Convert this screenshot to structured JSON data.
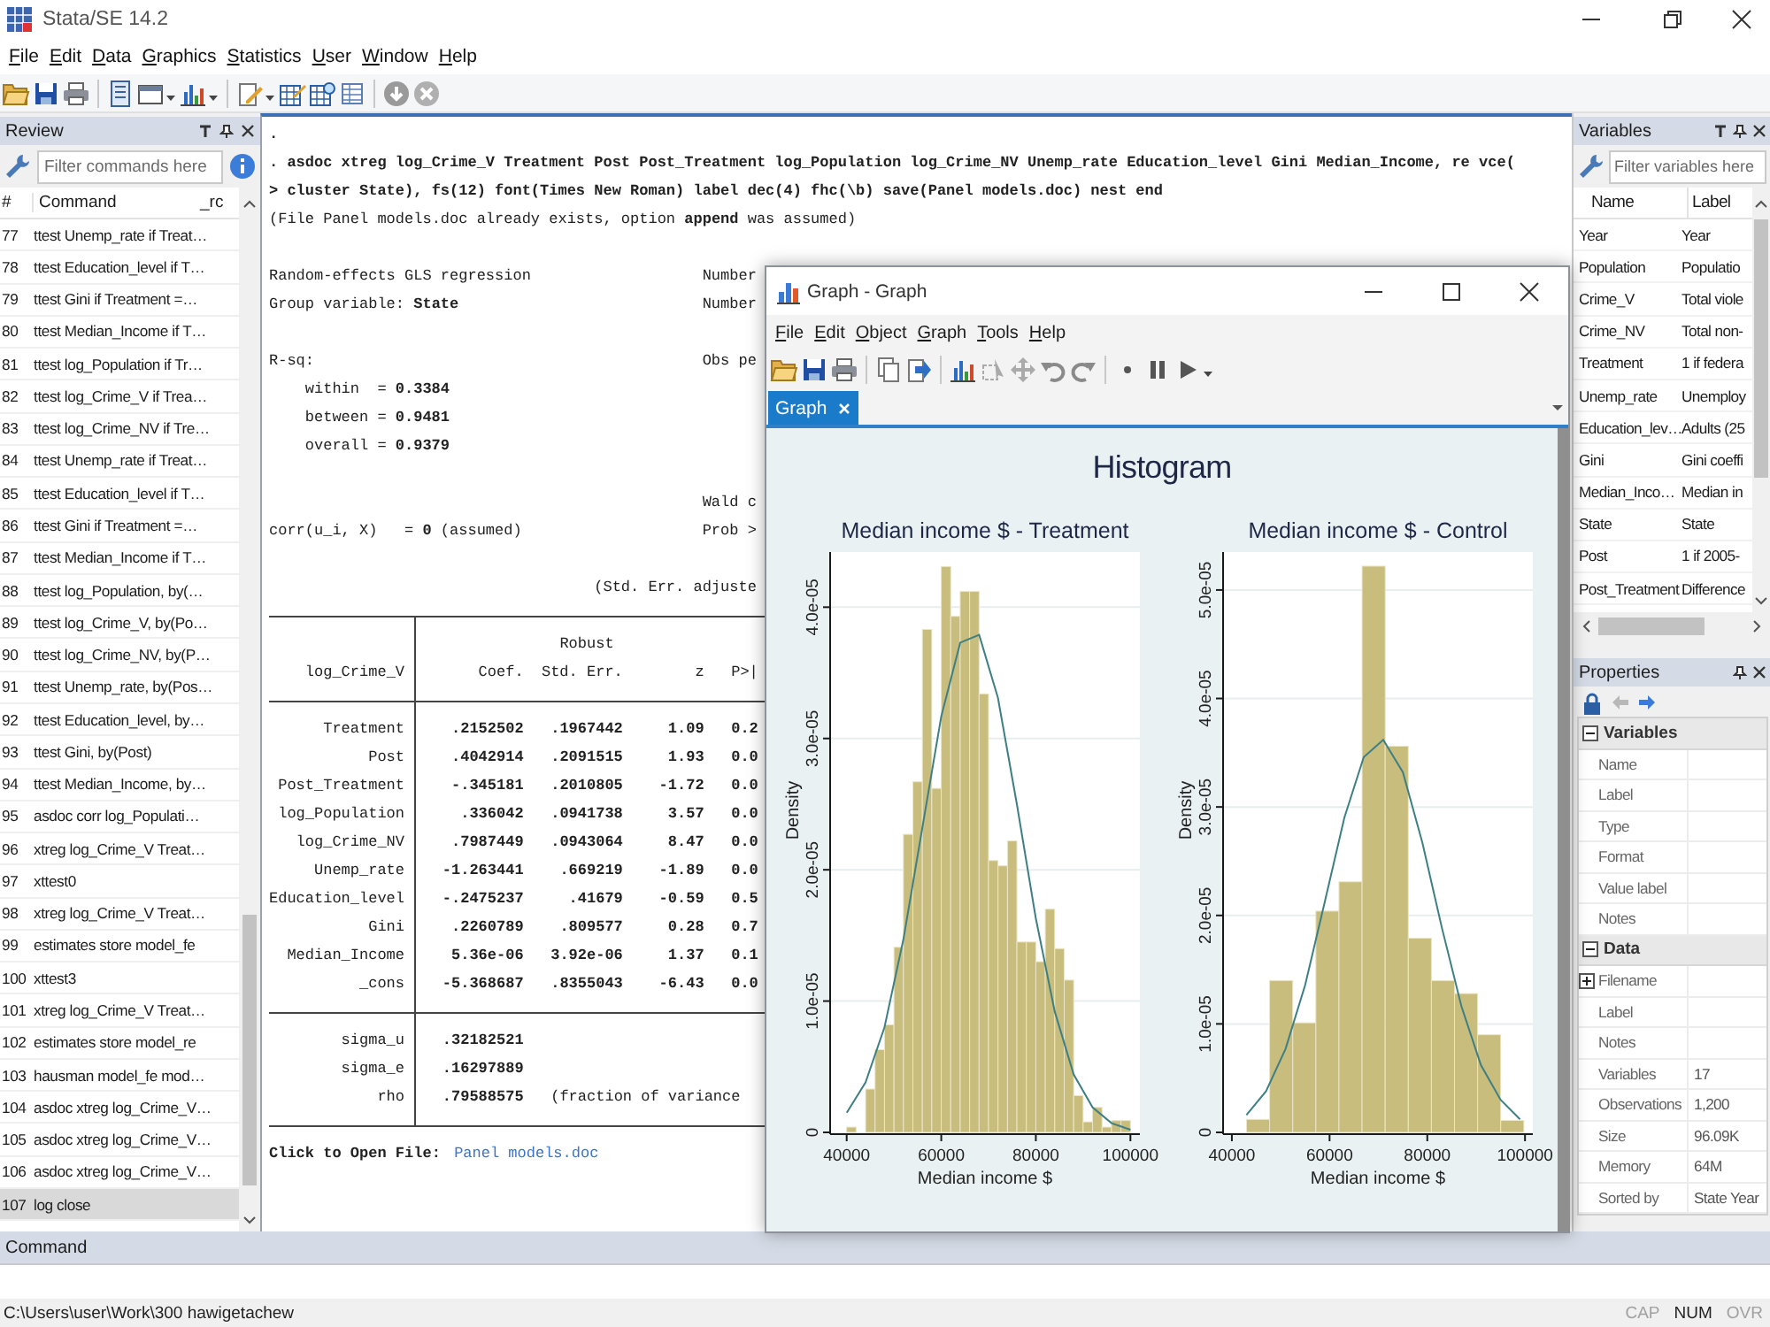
{
  "window": {
    "title": "Stata/SE 14.2"
  },
  "menu": [
    "File",
    "Edit",
    "Data",
    "Graphics",
    "Statistics",
    "User",
    "Window",
    "Help"
  ],
  "review": {
    "title": "Review",
    "filter": {
      "placeholder": "Filter commands here"
    },
    "columns": [
      "#",
      "Command",
      "_rc"
    ],
    "rows": [
      {
        "num": "77",
        "command": "ttest Unemp_rate if Treat…",
        "selected": false
      },
      {
        "num": "78",
        "command": "ttest Education_level if T…",
        "selected": false
      },
      {
        "num": "79",
        "command": "ttest Gini if Treatment =…",
        "selected": false
      },
      {
        "num": "80",
        "command": "ttest Median_Income if T…",
        "selected": false
      },
      {
        "num": "81",
        "command": "ttest log_Population if Tr…",
        "selected": false
      },
      {
        "num": "82",
        "command": "ttest log_Crime_V if Trea…",
        "selected": false
      },
      {
        "num": "83",
        "command": "ttest log_Crime_NV if Tre…",
        "selected": false
      },
      {
        "num": "84",
        "command": "ttest Unemp_rate if Treat…",
        "selected": false
      },
      {
        "num": "85",
        "command": "ttest Education_level if T…",
        "selected": false
      },
      {
        "num": "86",
        "command": "ttest Gini if Treatment =…",
        "selected": false
      },
      {
        "num": "87",
        "command": "ttest Median_Income if T…",
        "selected": false
      },
      {
        "num": "88",
        "command": "ttest log_Population, by(…",
        "selected": false
      },
      {
        "num": "89",
        "command": "ttest log_Crime_V, by(Po…",
        "selected": false
      },
      {
        "num": "90",
        "command": "ttest log_Crime_NV, by(P…",
        "selected": false
      },
      {
        "num": "91",
        "command": "ttest Unemp_rate, by(Pos…",
        "selected": false
      },
      {
        "num": "92",
        "command": "ttest Education_level, by…",
        "selected": false
      },
      {
        "num": "93",
        "command": "ttest Gini, by(Post)",
        "selected": false
      },
      {
        "num": "94",
        "command": "ttest Median_Income, by…",
        "selected": false
      },
      {
        "num": "95",
        "command": "asdoc corr log_Populati…",
        "selected": false
      },
      {
        "num": "96",
        "command": "xtreg log_Crime_V Treat…",
        "selected": false
      },
      {
        "num": "97",
        "command": "xttest0",
        "selected": false
      },
      {
        "num": "98",
        "command": "xtreg log_Crime_V Treat…",
        "selected": false
      },
      {
        "num": "99",
        "command": "estimates store model_fe",
        "selected": false
      },
      {
        "num": "100",
        "command": "xttest3",
        "selected": false
      },
      {
        "num": "101",
        "command": "xtreg log_Crime_V Treat…",
        "selected": false
      },
      {
        "num": "102",
        "command": "estimates store model_re",
        "selected": false
      },
      {
        "num": "103",
        "command": "hausman model_fe mod…",
        "selected": false
      },
      {
        "num": "104",
        "command": "asdoc xtreg log_Crime_V…",
        "selected": false
      },
      {
        "num": "105",
        "command": "asdoc xtreg log_Crime_V…",
        "selected": false
      },
      {
        "num": "106",
        "command": "asdoc xtreg log_Crime_V…",
        "selected": false
      },
      {
        "num": "107",
        "command": "log close",
        "selected": true
      }
    ]
  },
  "results": {
    "echo": [
      {
        "kind": "command",
        "text": "."
      },
      {
        "kind": "command",
        "text": ". asdoc xtreg log_Crime_V Treatment Post Post_Treatment log_Population log_Crime_NV Unemp_rate Education_level Gini Median_Income, re vce("
      },
      {
        "kind": "command",
        "text": "> cluster State), fs(12) font(Times New Roman) label dec(4) fhc(\\b) save(Panel models.doc) nest end"
      },
      {
        "kind": "note",
        "text": "(File Panel models.doc already exists, option **append** was assumed)"
      }
    ],
    "summary": [
      [
        {
          "kind": "plain",
          "text": "Random-effects GLS regression",
          "right": "Number"
        },
        {
          "kind": "plain",
          "text": "Group variable: **State**",
          "right": "Number"
        }
      ],
      [
        {
          "kind": "plain",
          "text": "R-sq:",
          "right": "Obs pe"
        },
        {
          "kind": "sub",
          "text": "within  = **0.3384**"
        },
        {
          "kind": "sub",
          "text": "between = **0.9481**"
        },
        {
          "kind": "sub",
          "text": "overall = **0.9379**"
        }
      ],
      [
        {
          "kind": "plain",
          "right": "Wald c"
        },
        {
          "kind": "plain",
          "text": "corr(u_i, X)   = **0** (assumed)",
          "right": "Prob >"
        }
      ],
      [
        {
          "kind": "note",
          "right": "(Std. Err. adjuste"
        }
      ]
    ],
    "table": {
      "group_header": "Robust",
      "columns": [
        "log_Crime_V",
        "Coef.",
        "Std. Err.",
        "z",
        "P>|"
      ],
      "rows": [
        [
          "Treatment",
          ".2152502",
          ".1967442",
          "1.09",
          "0.2"
        ],
        [
          "Post",
          ".4042914",
          ".2091515",
          "1.93",
          "0.0"
        ],
        [
          "Post_Treatment",
          "-.345181",
          ".2010805",
          "-1.72",
          "0.0"
        ],
        [
          "log_Population",
          ".336042",
          ".0941738",
          "3.57",
          "0.0"
        ],
        [
          "log_Crime_NV",
          ".7987449",
          ".0943064",
          "8.47",
          "0.0"
        ],
        [
          "Unemp_rate",
          "-1.263441",
          ".669219",
          "-1.89",
          "0.0"
        ],
        [
          "Education_level",
          "-.2475237",
          ".41679",
          "-0.59",
          "0.5"
        ],
        [
          "Gini",
          ".2260789",
          ".809577",
          "0.28",
          "0.7"
        ],
        [
          "Median_Income",
          "5.36e-06",
          "3.92e-06",
          "1.37",
          "0.1"
        ],
        [
          "_cons",
          "-5.368687",
          ".8355043",
          "-6.43",
          "0.0"
        ]
      ],
      "stats": [
        {
          "name": "sigma_u",
          "value": ".32182521"
        },
        {
          "name": "sigma_e",
          "value": ".16297889"
        },
        {
          "name": "rho",
          "value": ".79588575",
          "note": "(fraction of variance"
        }
      ]
    },
    "footer": {
      "label": "Click to Open File:",
      "link": "Panel models.doc"
    }
  },
  "graph_window": {
    "title": "Graph - Graph",
    "menu": [
      "File",
      "Edit",
      "Object",
      "Graph",
      "Tools",
      "Help"
    ],
    "tabs": [
      {
        "label": "Graph",
        "selected": true
      }
    ],
    "graph_title": "Histogram",
    "charts": [
      {
        "chart_data": {
          "type": "bar",
          "title": "Median income $ - Treatment",
          "grid": true,
          "xlabel": "Median income $",
          "ylabel": "Density",
          "xlim": [
            36500,
            102000
          ],
          "ylim": [
            0,
            4.42e-05
          ],
          "xticks": [
            40000,
            60000,
            80000,
            100000
          ],
          "yticks": [
            {
              "value": 0,
              "label": "0"
            },
            {
              "value": 1e-05,
              "label": "1.0e-05"
            },
            {
              "value": 2e-05,
              "label": "2.0e-05"
            },
            {
              "value": 3e-05,
              "label": "3.0e-05"
            },
            {
              "value": 4e-05,
              "label": "4.0e-05"
            }
          ],
          "series": [
            {
              "color": "#c8bd7c",
              "x": [
                41000,
                43000,
                45000,
                47000,
                49000,
                51000,
                53000,
                55000,
                57000,
                59000,
                61000,
                63000,
                65000,
                67000,
                69000,
                71000,
                73000,
                75000,
                77000,
                79000,
                81000,
                83000,
                85000,
                87000,
                89000,
                91000,
                93000,
                95000,
                97000,
                99000
              ],
              "values": [
                4e-07,
                0,
                3.3e-06,
                6.3e-06,
                8.2e-06,
                1.41e-05,
                2.27e-05,
                2.67e-05,
                3.83e-05,
                2.62e-05,
                4.31e-05,
                3.93e-05,
                4.12e-05,
                4.12e-05,
                3.34e-05,
                2.07e-05,
                2.03e-05,
                2.22e-05,
                1.45e-05,
                1.45e-05,
                1.3e-05,
                1.7e-05,
                1.4e-05,
                1.16e-05,
                2.8e-06,
                8e-07,
                1.9e-06,
                4e-07,
                9e-07,
                9e-07
              ]
            },
            {
              "type": "line",
              "color": "#3d7f84",
              "x": [
                40000,
                44000,
                48000,
                52000,
                56000,
                60000,
                64000,
                68000,
                72000,
                76000,
                80000,
                84000,
                88000,
                92000,
                96000,
                100000
              ],
              "values": [
                1.5e-06,
                3.8e-06,
                8e-06,
                1.47e-05,
                2.32e-05,
                3.17e-05,
                3.73e-05,
                3.79e-05,
                3.31e-05,
                2.5e-05,
                1.63e-05,
                9.2e-06,
                4.4e-06,
                1.9e-06,
                7e-07,
                2e-07
              ]
            }
          ]
        }
      },
      {
        "chart_data": {
          "type": "bar",
          "title": "Median income $ - Control",
          "grid": true,
          "xlabel": "Median income $",
          "ylabel": "Density",
          "xlim": [
            38200,
            101600
          ],
          "ylim": [
            0,
            5.35e-05
          ],
          "xticks": [
            40000,
            60000,
            80000,
            100000
          ],
          "yticks": [
            {
              "value": 0,
              "label": "0"
            },
            {
              "value": 1e-05,
              "label": "1.0e-05"
            },
            {
              "value": 2e-05,
              "label": "2.0e-05"
            },
            {
              "value": 3e-05,
              "label": "3.0e-05"
            },
            {
              "value": 4e-05,
              "label": "4.0e-05"
            },
            {
              "value": 5e-05,
              "label": "5.0e-05"
            }
          ],
          "series": [
            {
              "color": "#c8bd7c",
              "x": [
                45365,
                50095,
                54825,
                59555,
                64285,
                69015,
                73745,
                78475,
                83205,
                87935,
                92665,
                97395
              ],
              "values": [
                1.2e-06,
                1.4e-05,
                1.01e-05,
                2.04e-05,
                2.31e-05,
                5.22e-05,
                3.56e-05,
                1.79e-05,
                1.4e-05,
                1.28e-05,
                9e-06,
                1.1e-06
              ]
            },
            {
              "type": "line",
              "color": "#3d7f84",
              "x": [
                43000,
                47000,
                51000,
                55000,
                59000,
                63000,
                67000,
                71000,
                75000,
                79000,
                83000,
                87000,
                91000,
                95000,
                99000
              ],
              "values": [
                1.6e-06,
                3.8e-06,
                7.7e-06,
                1.36e-05,
                2.12e-05,
                2.9e-05,
                3.46e-05,
                3.62e-05,
                3.32e-05,
                2.67e-05,
                1.88e-05,
                1.16e-05,
                6.2e-06,
                3e-06,
                1.2e-06
              ]
            }
          ]
        }
      }
    ]
  },
  "variables": {
    "title": "Variables",
    "filter": {
      "placeholder": "Filter variables here"
    },
    "columns": [
      "Name",
      "Label"
    ],
    "rows": [
      {
        "name": "Year",
        "label": "Year",
        "selected": false
      },
      {
        "name": "Population",
        "label": "Populatio",
        "selected": false
      },
      {
        "name": "Crime_V",
        "label": "Total viole",
        "selected": false
      },
      {
        "name": "Crime_NV",
        "label": "Total non-",
        "selected": false
      },
      {
        "name": "Treatment",
        "label": "1 if federa",
        "selected": false
      },
      {
        "name": "Unemp_rate",
        "label": "Unemploy",
        "selected": false
      },
      {
        "name": "Education_lev…",
        "label": "Adults (25",
        "selected": false
      },
      {
        "name": "Gini",
        "label": "Gini coeffi",
        "selected": false
      },
      {
        "name": "Median_Inco…",
        "label": "Median in",
        "selected": false
      },
      {
        "name": "State",
        "label": "State",
        "selected": false
      },
      {
        "name": "Post",
        "label": "1 if 2005-",
        "selected": false
      },
      {
        "name": "Post_Treatment",
        "label": "Difference",
        "selected": false
      }
    ]
  },
  "properties": {
    "title": "Properties",
    "sections": [
      {
        "title": "Variables",
        "expanded": true,
        "rows": [
          {
            "kind": "field",
            "name": "Name"
          },
          {
            "kind": "field",
            "name": "Label"
          },
          {
            "kind": "field",
            "name": "Type"
          },
          {
            "kind": "field",
            "name": "Format"
          },
          {
            "kind": "field",
            "name": "Value label"
          },
          {
            "kind": "field",
            "name": "Notes"
          }
        ]
      },
      {
        "title": "Data",
        "expanded": true,
        "rows": [
          {
            "kind": "group",
            "name": "Filename",
            "expanded": false
          },
          {
            "kind": "field",
            "name": "Label"
          },
          {
            "kind": "field",
            "name": "Notes"
          },
          {
            "kind": "field",
            "name": "Variables",
            "value": "17"
          },
          {
            "kind": "field",
            "name": "Observations",
            "value": "1,200"
          },
          {
            "kind": "field",
            "name": "Size",
            "value": "96.09K"
          },
          {
            "kind": "field",
            "name": "Memory",
            "value": "64M"
          },
          {
            "kind": "field",
            "name": "Sorted by",
            "value": "State Year"
          }
        ]
      }
    ]
  },
  "command_pane": {
    "title": "Command"
  },
  "status_bar": {
    "path": "C:\\Users\\user\\Work\\300 hawigetachew",
    "indicators": [
      {
        "label": "CAP",
        "on": false
      },
      {
        "label": "NUM",
        "on": true
      },
      {
        "label": "OVR",
        "on": false
      }
    ]
  }
}
